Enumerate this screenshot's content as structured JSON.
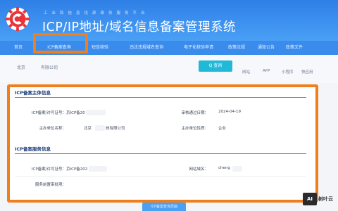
{
  "header": {
    "subtitle": "工业和信息化部政务服务平台",
    "title": "ICP/IP地址/域名信息备案管理系统"
  },
  "nav": {
    "items": [
      "首页",
      "ICP备案查询",
      "短信核验",
      "违法违规域名查询",
      "电子化核验申请",
      "政策法规",
      "通知公告",
      "政策文件"
    ],
    "active_index": 1
  },
  "toolbar": {
    "region": "北京",
    "company": "有限公司",
    "query_button": "Q 查询",
    "links": [
      "网站",
      "APP",
      "小程序",
      "快应用"
    ]
  },
  "subject_section": {
    "title": "ICP备案主体信息",
    "fields": {
      "license_label": "ICP备案/许可证号：",
      "license_value": "京ICP备20",
      "approval_date_label": "审核通过日期：",
      "approval_date_value": "2024-04-19",
      "organizer_label": "主办单位名称：",
      "organizer_value_a": "北京",
      "organizer_value_b": "技有限公司",
      "organizer_type_label": "主办单位性质：",
      "organizer_type_value": "企业"
    }
  },
  "service_section": {
    "title": "ICP备案服务信息",
    "fields": {
      "license_label": "ICP备案/许可证号：",
      "license_value": "京ICP备202",
      "domain_label": "网站域名：",
      "domain_value": "cheng",
      "pre_approval_label": "服务前置审批项："
    }
  },
  "bottom_button": "ICP备案查询页面",
  "watermark": {
    "badge": "AI",
    "text": "树叶云"
  },
  "colors": {
    "header_blue": "#3a8cec",
    "highlight_orange": "#f07e1d",
    "query_button": "#22b8d8",
    "logo_red": "#e8333a"
  }
}
